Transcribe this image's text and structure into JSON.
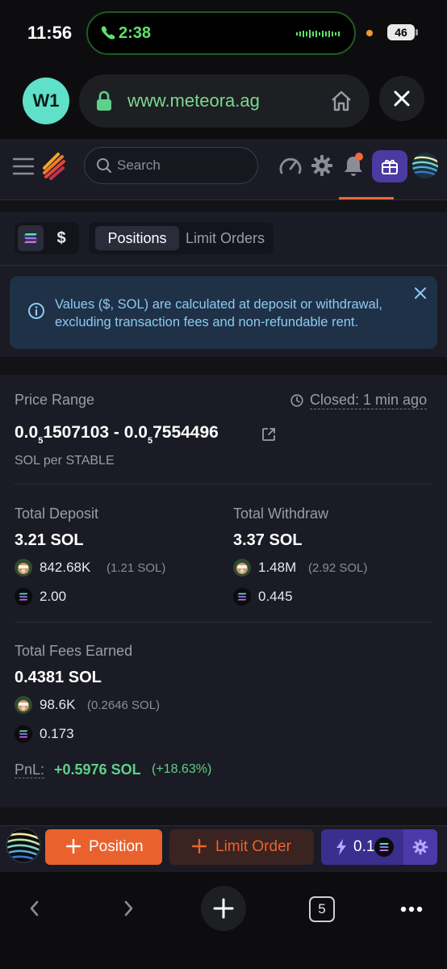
{
  "status_bar": {
    "time": "11:56",
    "call_timer": "2:38",
    "battery": "46"
  },
  "browser": {
    "avatar_initials": "W1",
    "url": "www.meteora.ag"
  },
  "header": {
    "search_placeholder": "Search"
  },
  "toggle": {
    "usd_symbol": "$"
  },
  "tabs": [
    {
      "label": "Positions",
      "active": true
    },
    {
      "label": "Limit Orders",
      "active": false
    }
  ],
  "info_banner": {
    "text": "Values ($, SOL) are calculated at deposit or withdrawal, excluding transaction fees and non-refundable rent."
  },
  "position": {
    "price_range_label": "Price Range",
    "closed_label": "Closed: 1 min ago",
    "range_a_lead": "0.0",
    "range_a_sub": "5",
    "range_a_tail": "1507103",
    "range_sep": " - ",
    "range_b_lead": "0.0",
    "range_b_sub": "5",
    "range_b_tail": "7554496",
    "unit": "SOL per STABLE",
    "total_deposit": {
      "label": "Total Deposit",
      "value": "3.21 SOL",
      "token_amount": "842.68K",
      "token_note": "(1.21 SOL)",
      "sol_amount": "2.00"
    },
    "total_withdraw": {
      "label": "Total Withdraw",
      "value": "3.37 SOL",
      "token_amount": "1.48M",
      "token_note": "(2.92 SOL)",
      "sol_amount": "0.445"
    },
    "total_fees": {
      "label": "Total Fees Earned",
      "value": "0.4381 SOL",
      "token_amount": "98.6K",
      "token_note": "(0.2646 SOL)",
      "sol_amount": "0.173"
    },
    "pnl": {
      "label": "PnL:",
      "value": "+0.5976 SOL",
      "percent": "(+18.63%)"
    }
  },
  "action_bar": {
    "position_label": "Position",
    "limit_label": "Limit Order",
    "fast_amount": "0.1"
  },
  "nav": {
    "tab_count": "5"
  },
  "colors": {
    "accent_orange": "#e9622e",
    "accent_purple": "#3a2e8f",
    "positive_green": "#5fd08a",
    "info_blue": "#8ec9f2"
  }
}
